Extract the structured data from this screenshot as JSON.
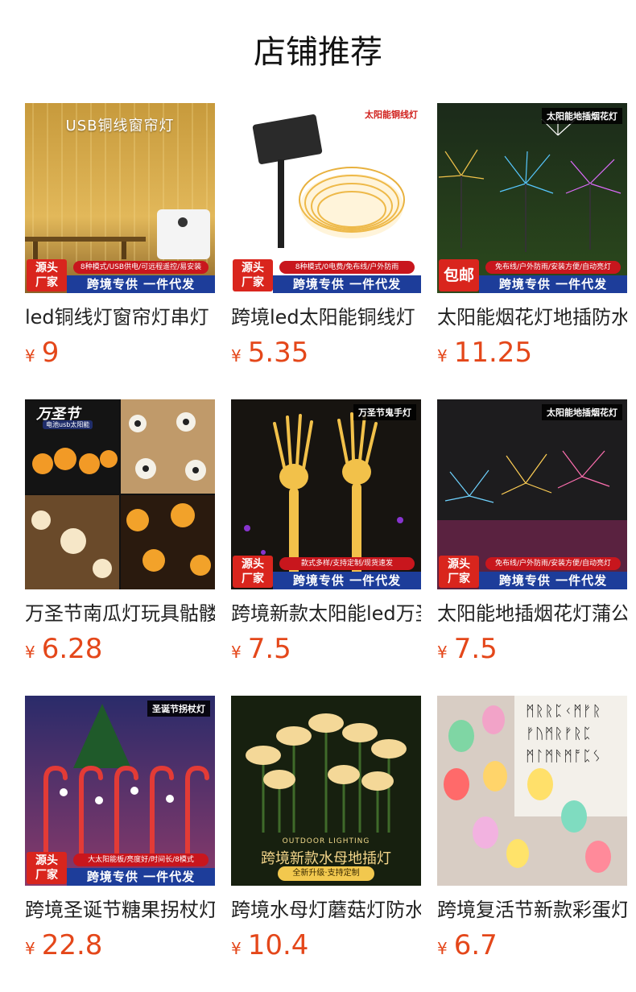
{
  "page": {
    "title": "店铺推荐"
  },
  "common": {
    "currency": "¥",
    "strip_text": "跨境专供 一件代发"
  },
  "products": [
    {
      "name": "led铜线灯窗帘灯串灯",
      "price": "9",
      "image": {
        "overlay_title": "USB铜线窗帘灯",
        "badge_lines": [
          "源头",
          "厂家"
        ],
        "feature": "8种模式/USB供电/可远程遥控/易安装"
      }
    },
    {
      "name": "跨境led太阳能铜线灯",
      "price": "5.35",
      "image": {
        "corner_tag": "太阳能铜线灯",
        "badge_lines": [
          "源头",
          "厂家"
        ],
        "feature": "8种模式/0电费/免布线/户外防雨"
      }
    },
    {
      "name": "太阳能烟花灯地插防水",
      "price": "11.25",
      "image": {
        "corner_tag": "太阳能地插烟花灯",
        "badge_single": "包邮",
        "feature": "免布线/户外防雨/安装方便/自动亮灯"
      }
    },
    {
      "name": "万圣节南瓜灯玩具骷髅",
      "price": "6.28",
      "image": {
        "pic_text": "万圣节",
        "pic_text2": "电池usb太阳能"
      }
    },
    {
      "name": "跨境新款太阳能led万圣节",
      "price": "7.5",
      "image": {
        "corner_tag": "万圣节鬼手灯",
        "badge_lines": [
          "源头",
          "厂家"
        ],
        "feature": "款式多样/支持定制/现货速发"
      }
    },
    {
      "name": "太阳能地插烟花灯蒲公英",
      "price": "7.5",
      "image": {
        "corner_tag": "太阳能地插烟花灯",
        "badge_lines": [
          "源头",
          "厂家"
        ],
        "feature": "免布线/户外防雨/安装方便/自动亮灯"
      }
    },
    {
      "name": "跨境圣诞节糖果拐杖灯",
      "price": "22.8",
      "image": {
        "corner_tag": "圣诞节拐杖灯",
        "badge_lines": [
          "源头",
          "厂家"
        ],
        "feature": "大太阳能板/亮度好/时间长/8模式"
      }
    },
    {
      "name": "跨境水母灯蘑菇灯防水",
      "price": "10.4",
      "image": {
        "brand_line": "OUTDOOR LIGHTING",
        "caption": "跨境新款水母地插灯",
        "pill": "全新升级·支持定制"
      }
    },
    {
      "name": "跨境复活节新款彩蛋灯",
      "price": "6.7",
      "image": {
        "runes": "ᛗᚱᚱᛈᚲᛗᚠᚱ ᚠᚢᛗᚱᚠᚱᛈ ᛗᛚᛗᚫᛗᚩᛈᛊ"
      }
    }
  ]
}
